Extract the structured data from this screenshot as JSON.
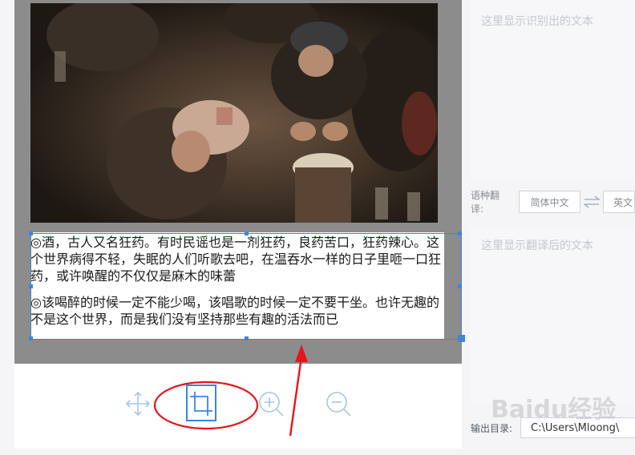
{
  "document": {
    "paragraph_1": "◎酒，古人又名狂药。有时民谣也是一剂狂药，良药苦口，狂药辣心。这个世界病得不轻，失眠的人们听歌去吧，在温吞水一样的日子里咂一口狂药，或许唤醒的不仅仅是麻木的味蕾",
    "paragraph_2": "◎该喝醉的时候一定不能少喝，该唱歌的时候一定不要干坐。也许无趣的不是这个世界，而是我们没有坚持那些有趣的活法而已"
  },
  "toolbar": {
    "tools": [
      {
        "name": "move",
        "icon": "move-arrows-icon",
        "active": false
      },
      {
        "name": "crop",
        "icon": "crop-icon",
        "active": true
      },
      {
        "name": "zoom-in",
        "icon": "zoom-in-icon",
        "active": false
      },
      {
        "name": "zoom-out",
        "icon": "zoom-out-icon",
        "active": false
      }
    ]
  },
  "recognition": {
    "placeholder": "这里显示识别出的文本"
  },
  "translation": {
    "label": "语种翻译:",
    "source_lang": "简体中文",
    "target_lang": "英文",
    "swap_icon": "swap-arrows-icon",
    "placeholder": "这里显示翻译后的文本"
  },
  "output": {
    "label": "输出目录:",
    "path": "C:\\Users\\Mloong\\"
  },
  "watermark": "Baidu经验",
  "colors": {
    "accent": "#3b86e0",
    "annotation_red": "#e8141c",
    "canvas_gray": "#8c8c8c",
    "placeholder": "#c4c7d0"
  }
}
